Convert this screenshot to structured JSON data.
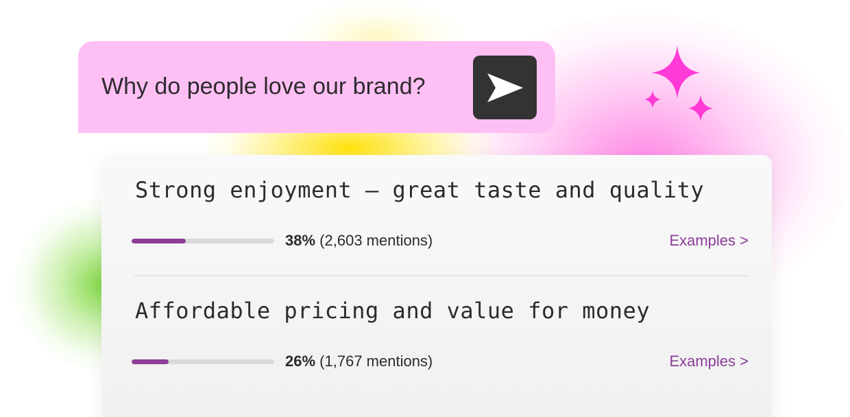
{
  "question": {
    "text": "Why do people love our brand?",
    "send_icon": "send-icon"
  },
  "results": [
    {
      "title": "Strong enjoyment – great taste and quality",
      "percent_label": "38%",
      "mentions_label": "(2,603 mentions)",
      "share": 0.38,
      "link_label": "Examples >"
    },
    {
      "title": "Affordable pricing and value for money",
      "percent_label": "26%",
      "mentions_label": "(1,767 mentions)",
      "share": 0.26,
      "link_label": "Examples >"
    }
  ],
  "colors": {
    "question_bg": "#fec0f4",
    "send_button_bg": "#333333",
    "accent_purple": "#8f3d97",
    "sparkle_pink": "#ff3ad6"
  }
}
